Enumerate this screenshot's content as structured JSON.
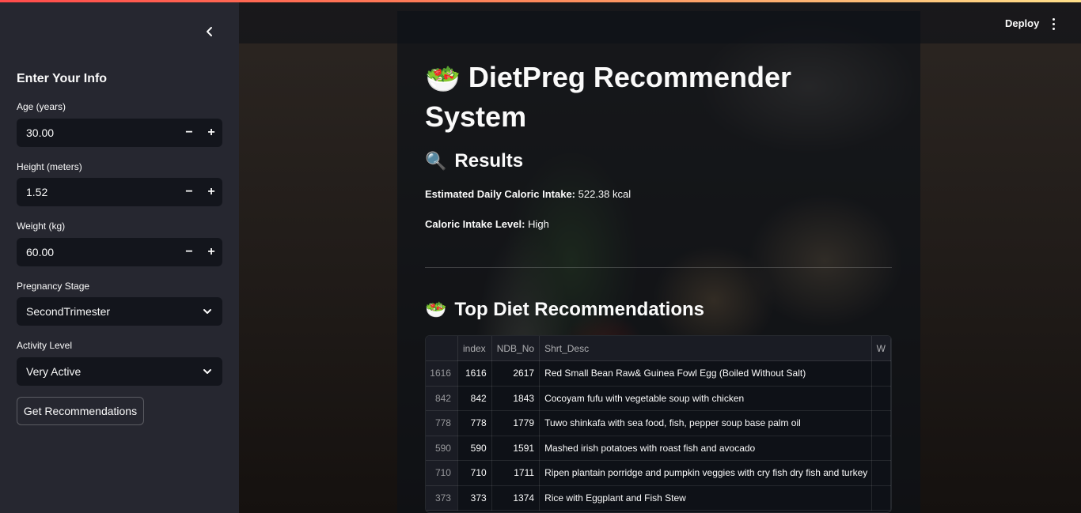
{
  "header": {
    "deploy_label": "Deploy",
    "menu_icon": "kebab-menu-icon"
  },
  "sidebar": {
    "title": "Enter Your Info",
    "age": {
      "label": "Age (years)",
      "value": "30.00"
    },
    "height": {
      "label": "Height (meters)",
      "value": "1.52"
    },
    "weight": {
      "label": "Weight (kg)",
      "value": "60.00"
    },
    "stepper": {
      "minus": "−",
      "plus": "+"
    },
    "pregnancy_stage": {
      "label": "Pregnancy Stage",
      "value": "SecondTrimester"
    },
    "activity_level": {
      "label": "Activity Level",
      "value": "Very Active"
    },
    "button_label": "Get Recommendations"
  },
  "main": {
    "title_emoji": "🥗",
    "title": "DietPreg Recommender System",
    "results_emoji": "🔍",
    "results_heading": "Results",
    "caloric_intake_label": "Estimated Daily Caloric Intake:",
    "caloric_intake_value": " 522.38 kcal",
    "intake_level_label": "Caloric Intake Level:",
    "intake_level_value": " High",
    "rec_emoji": "🥗",
    "rec_heading": "Top Diet Recommendations",
    "table": {
      "columns": [
        "",
        "index",
        "NDB_No",
        "Shrt_Desc",
        "W"
      ],
      "rows": [
        [
          "1616",
          "1616",
          "2617",
          "Red Small Bean Raw& Guinea Fowl Egg (Boiled Without Salt)"
        ],
        [
          "842",
          "842",
          "1843",
          "Cocoyam fufu with vegetable soup with chicken"
        ],
        [
          "778",
          "778",
          "1779",
          "Tuwo shinkafa with sea food, fish, pepper soup base palm oil"
        ],
        [
          "590",
          "590",
          "1591",
          "Mashed irish potatoes with roast fish and avocado"
        ],
        [
          "710",
          "710",
          "1711",
          "Ripen plantain porridge and pumpkin veggies with cry fish dry fish and turkey"
        ],
        [
          "373",
          "373",
          "1374",
          "Rice with Eggplant and Fish Stew"
        ]
      ]
    }
  }
}
